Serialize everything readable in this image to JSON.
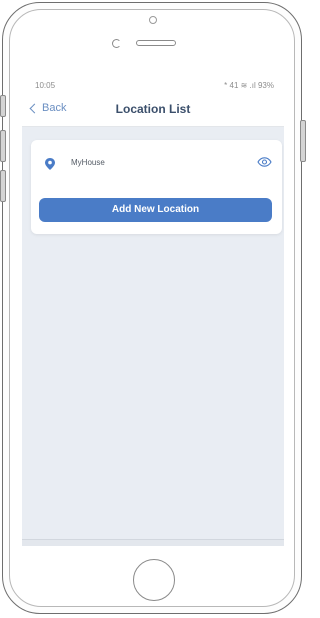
{
  "status_bar": {
    "time": "10:05",
    "right_indicators": "* 41 ≋ .ıl 93%"
  },
  "nav": {
    "back_label": "Back",
    "title": "Location List"
  },
  "locations": [
    {
      "name": "MyHouse"
    }
  ],
  "actions": {
    "add_location_label": "Add New Location"
  },
  "colors": {
    "accent": "#4a7cc7",
    "screen_background": "#e9edf3",
    "title_text": "#3b4f6b"
  },
  "icons": {
    "location": "map-pin-icon",
    "visibility": "eye-icon",
    "back": "chevron-left-icon"
  }
}
